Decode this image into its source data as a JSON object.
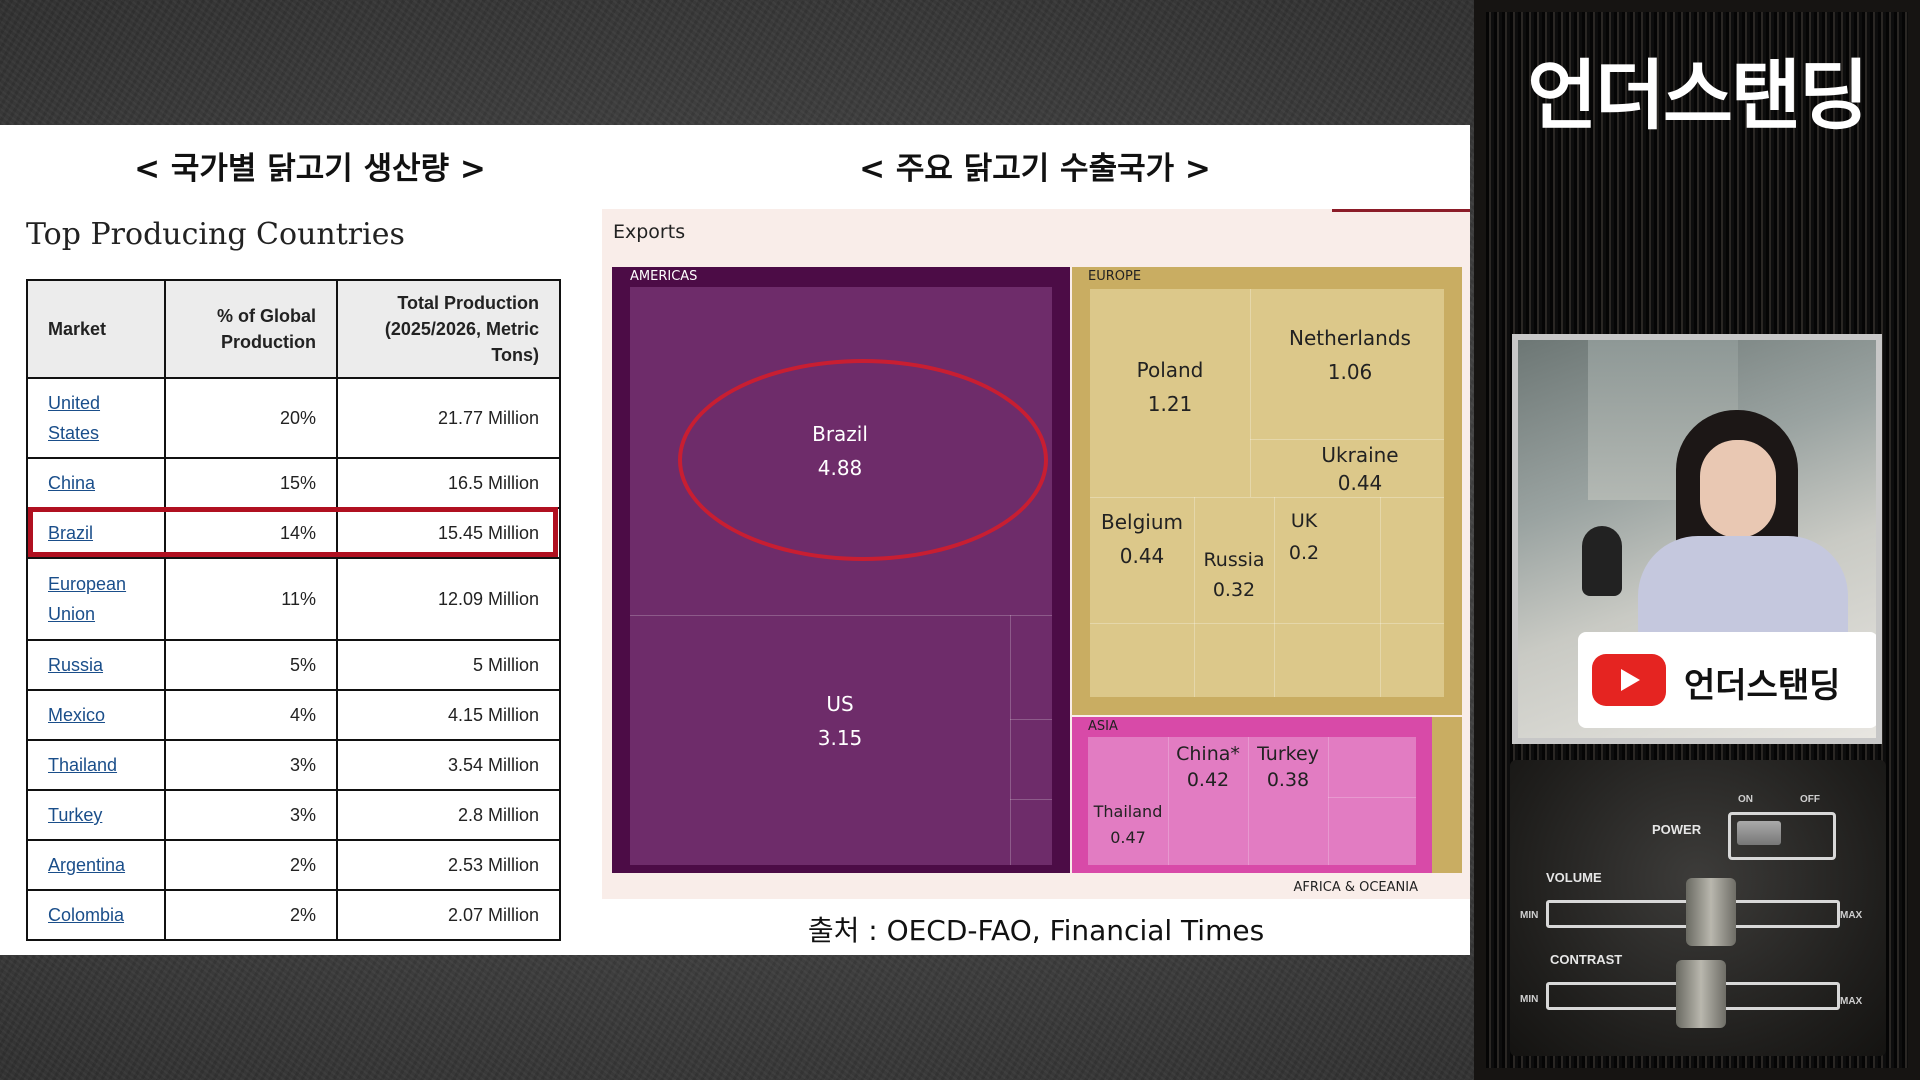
{
  "slide": {
    "left_title": "< 국가별 닭고기 생산량 >",
    "right_title": "< 주요 닭고기 수출국가 >",
    "source": "출처 : OECD-FAO, Financial Times"
  },
  "production_table": {
    "heading": "Top Producing Countries",
    "headers": [
      "Market",
      "% of Global Production",
      "Total Production (2025/2026, Metric Tons)"
    ],
    "rows": [
      {
        "market": "United States",
        "share": "20%",
        "total": "21.77 Million"
      },
      {
        "market": "China",
        "share": "15%",
        "total": "16.5 Million"
      },
      {
        "market": "Brazil",
        "share": "14%",
        "total": "15.45 Million"
      },
      {
        "market": "European Union",
        "share": "11%",
        "total": "12.09 Million"
      },
      {
        "market": "Russia",
        "share": "5%",
        "total": "5 Million"
      },
      {
        "market": "Mexico",
        "share": "4%",
        "total": "4.15 Million"
      },
      {
        "market": "Thailand",
        "share": "3%",
        "total": "3.54 Million"
      },
      {
        "market": "Turkey",
        "share": "3%",
        "total": "2.8 Million"
      },
      {
        "market": "Argentina",
        "share": "2%",
        "total": "2.53 Million"
      },
      {
        "market": "Colombia",
        "share": "2%",
        "total": "2.07 Million"
      }
    ],
    "highlighted_row": "Brazil",
    "highlight_color": "#b01020"
  },
  "exports_treemap": {
    "label": "Exports",
    "regions": {
      "americas": {
        "label": "AMERICAS",
        "color": "#6e2c6a"
      },
      "europe": {
        "label": "EUROPE",
        "color": "#dcc88a"
      },
      "asia": {
        "label": "ASIA",
        "color": "#e27cc2"
      },
      "africa_oceania": {
        "label": "AFRICA & OCEANIA"
      }
    },
    "countries": {
      "brazil": {
        "name": "Brazil",
        "value": "4.88"
      },
      "us": {
        "name": "US",
        "value": "3.15"
      },
      "poland": {
        "name": "Poland",
        "value": "1.21"
      },
      "netherlands": {
        "name": "Netherlands",
        "value": "1.06"
      },
      "ukraine": {
        "name": "Ukraine",
        "value": "0.44"
      },
      "belgium": {
        "name": "Belgium",
        "value": "0.44"
      },
      "russia": {
        "name": "Russia",
        "value": "0.32"
      },
      "uk": {
        "name": "UK",
        "value": "0.2"
      },
      "china": {
        "name": "China*",
        "value": "0.42"
      },
      "turkey": {
        "name": "Turkey",
        "value": "0.38"
      },
      "thailand": {
        "name": "Thailand",
        "value": "0.47"
      }
    }
  },
  "channel": {
    "name": "언더스탠딩",
    "badge_name": "언더스탠딩"
  },
  "tv_controls": {
    "power": "POWER",
    "on": "ON",
    "off": "OFF",
    "volume": "VOLUME",
    "contrast": "CONTRAST",
    "min": "MIN",
    "max": "MAX"
  }
}
